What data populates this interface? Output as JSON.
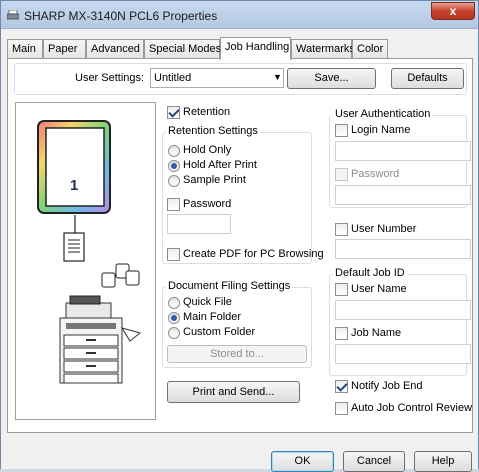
{
  "window": {
    "title": "SHARP MX-3140N PCL6 Properties",
    "close_glyph": "x"
  },
  "tabs": [
    {
      "label": "Main"
    },
    {
      "label": "Paper"
    },
    {
      "label": "Advanced"
    },
    {
      "label": "Special Modes"
    },
    {
      "label": "Job Handling"
    },
    {
      "label": "Watermarks"
    },
    {
      "label": "Color"
    }
  ],
  "user_settings": {
    "label": "User Settings:",
    "value": "Untitled",
    "save_label": "Save...",
    "defaults_label": "Defaults"
  },
  "preview": {
    "page_number": "1"
  },
  "retention": {
    "checkbox_label": "Retention",
    "checked": true,
    "group_label": "Retention Settings",
    "options": [
      "Hold Only",
      "Hold After Print",
      "Sample Print"
    ],
    "selected": "Hold After Print",
    "password_label": "Password",
    "password_value": "",
    "pdf_label": "Create PDF for PC Browsing"
  },
  "document_filing": {
    "group_label": "Document Filing Settings",
    "options": [
      "Quick File",
      "Main Folder",
      "Custom Folder"
    ],
    "selected": "Main Folder",
    "stored_to_label": "Stored to..."
  },
  "print_send_label": "Print and Send...",
  "user_auth": {
    "group_label": "User Authentication",
    "login_name_label": "Login Name",
    "login_name_value": "",
    "password_label": "Password",
    "password_value": ""
  },
  "user_number": {
    "label": "User Number",
    "value": ""
  },
  "default_job_id": {
    "group_label": "Default Job ID",
    "user_name_label": "User Name",
    "user_name_value": "",
    "job_name_label": "Job Name",
    "job_name_value": ""
  },
  "notify_job_end": {
    "label": "Notify Job End",
    "checked": true
  },
  "auto_job_control": {
    "label": "Auto Job Control Review",
    "checked": false
  },
  "footer": {
    "ok_label": "OK",
    "cancel_label": "Cancel",
    "help_label": "Help"
  }
}
